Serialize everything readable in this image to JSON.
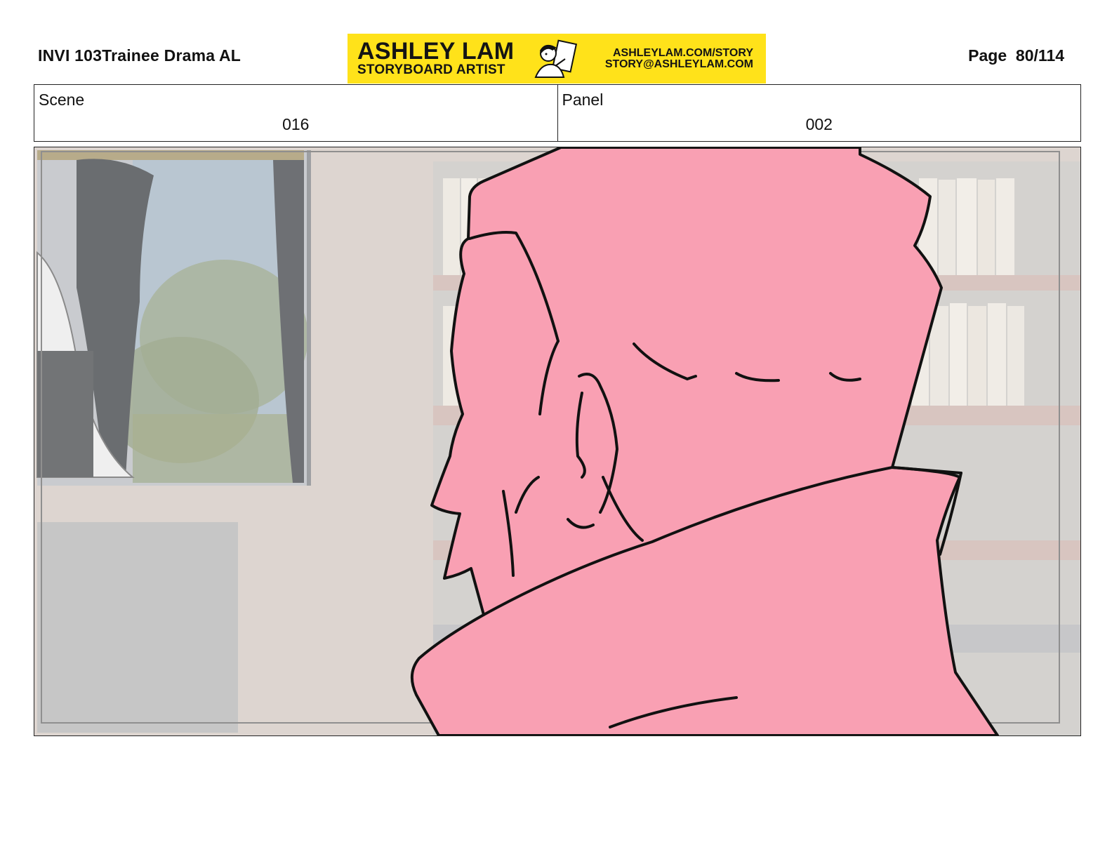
{
  "header": {
    "production": "INVI 103Trainee Drama AL",
    "page_label": "Page",
    "page_number": "80/114"
  },
  "banner": {
    "name": "ASHLEY LAM",
    "role": "STORYBOARD ARTIST",
    "url": "ASHLEYLAM.COM/STORY",
    "email": "STORY@ASHLEYLAM.COM",
    "background": "#ffe21a"
  },
  "meta": {
    "scene_label": "Scene",
    "scene_value": "016",
    "panel_label": "Panel",
    "panel_value": "002"
  },
  "panel": {
    "figure_fill": "#f9a0b3",
    "line_color": "#111111",
    "background_tone": "#ddd5d0"
  }
}
